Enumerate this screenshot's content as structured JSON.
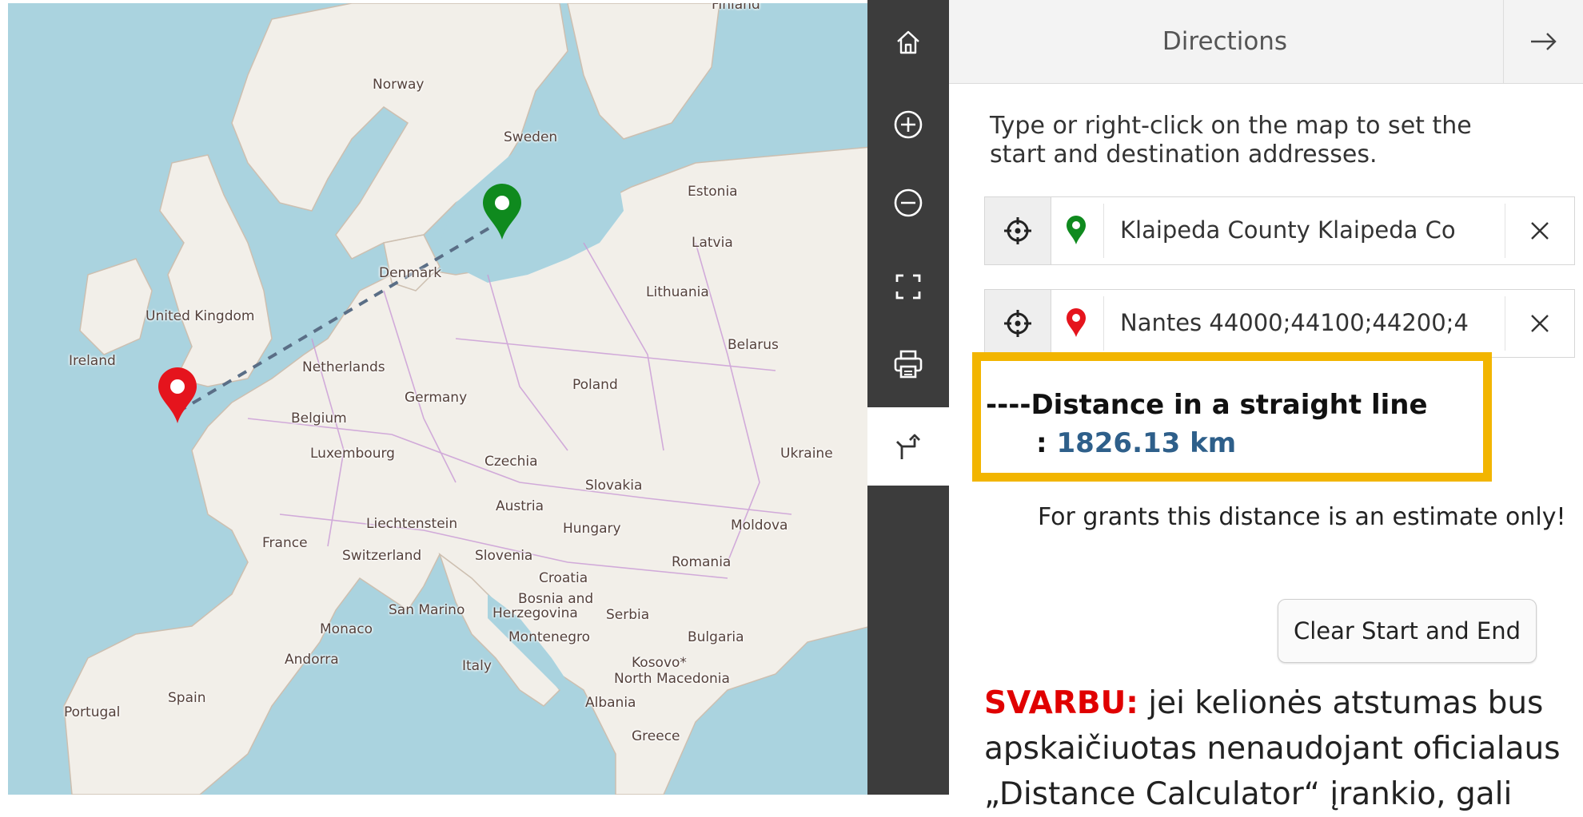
{
  "map": {
    "labels": {
      "finland": "Finland",
      "norway": "Norway",
      "sweden": "Sweden",
      "estonia": "Estonia",
      "latvia": "Latvia",
      "lithuania": "Lithuania",
      "denmark": "Denmark",
      "united_kingdom": "United Kingdom",
      "ireland": "Ireland",
      "netherlands": "Netherlands",
      "belarus": "Belarus",
      "germany": "Germany",
      "poland": "Poland",
      "belgium": "Belgium",
      "luxembourg": "Luxembourg",
      "czechia": "Czechia",
      "ukraine": "Ukraine",
      "slovakia": "Slovakia",
      "austria": "Austria",
      "liechtenstein": "Liechtenstein",
      "hungary": "Hungary",
      "moldova": "Moldova",
      "france": "France",
      "switzerland": "Switzerland",
      "slovenia": "Slovenia",
      "romania": "Romania",
      "croatia": "Croatia",
      "bosnia_1": "Bosnia and",
      "bosnia_2": "Herzegovina",
      "serbia": "Serbia",
      "san_marino": "San Marino",
      "monaco": "Monaco",
      "montenegro": "Montenegro",
      "bulgaria": "Bulgaria",
      "andorra": "Andorra",
      "italy": "Italy",
      "kosovo": "Kosovo*",
      "north_macedonia": "North Macedonia",
      "portugal": "Portugal",
      "spain": "Spain",
      "albania": "Albania",
      "greece": "Greece"
    },
    "start_marker_color": "#0f8a1e",
    "end_marker_color": "#e5141d",
    "route_line_color": "#5a6e86"
  },
  "toolbar": {
    "items": [
      {
        "icon": "home-icon"
      },
      {
        "icon": "zoom-in-icon"
      },
      {
        "icon": "zoom-out-icon"
      },
      {
        "icon": "fullscreen-icon"
      },
      {
        "icon": "print-icon"
      },
      {
        "icon": "directions-icon",
        "active": true
      }
    ]
  },
  "panel": {
    "title": "Directions",
    "close_arrow": "→",
    "instructions": "Type or right-click on the map to set the start and destination addresses.",
    "start": {
      "value": "Klaipeda County  Klaipeda Co",
      "clear": "×",
      "pin_color": "#0f8a1e"
    },
    "end": {
      "value": "Nantes 44000;44100;44200;4",
      "clear": "×",
      "pin_color": "#e5141d"
    },
    "distance_label": "----Distance in a straight line",
    "distance_colon": ": ",
    "distance_value": "1826.13 km",
    "estimate_note": "For grants this distance is an estimate only!",
    "clear_button": "Clear Start and End",
    "important_label": "SVARBU:",
    "important_text": " jei kelionės atstumas bus apskaičiuotas nenaudojant oficialaus „Distance Calculator“ įrankio, gali"
  },
  "colors": {
    "highlight_border": "#f2b500",
    "distance_value": "#2e5f8a",
    "important_label": "#e00000"
  }
}
